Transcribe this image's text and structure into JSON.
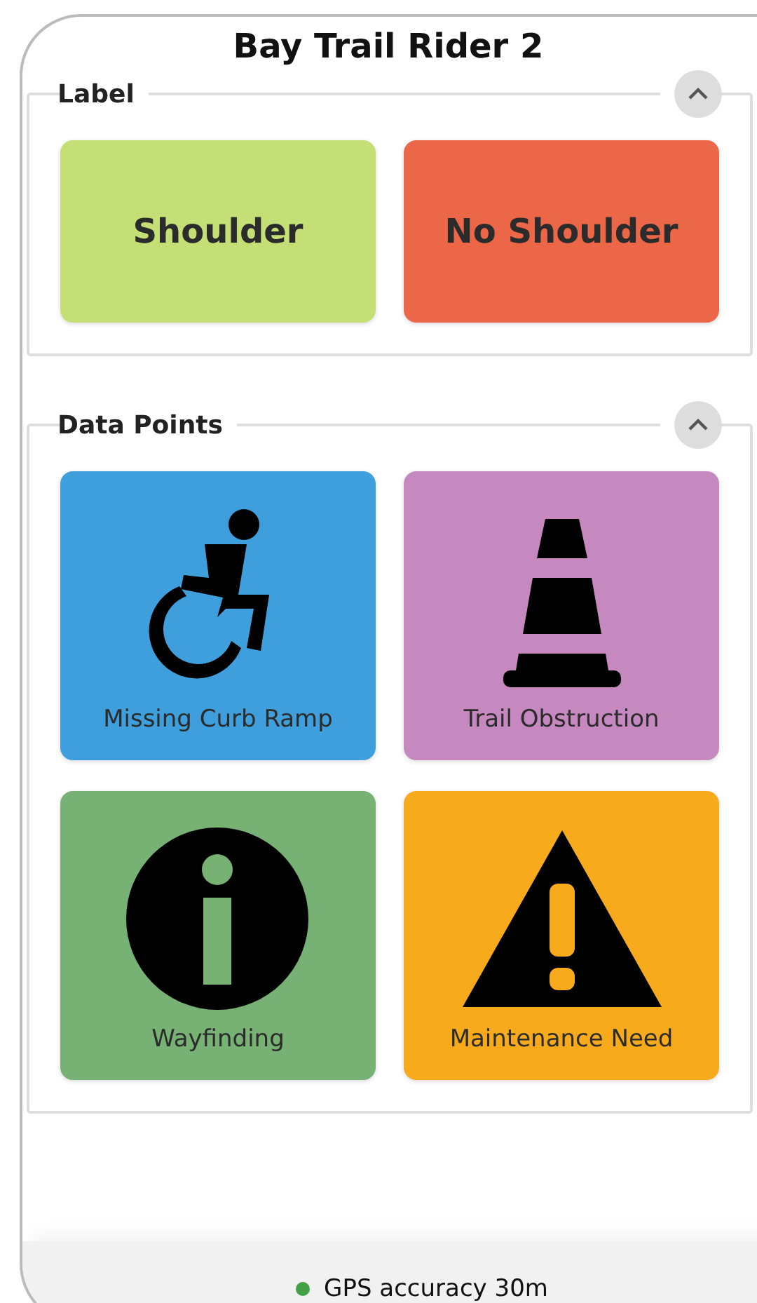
{
  "title": "Bay Trail Rider 2",
  "sections": [
    {
      "heading": "Label",
      "expanded": true,
      "kind": "label",
      "tiles": [
        {
          "label": "Shoulder",
          "color": "#c4df75"
        },
        {
          "label": "No Shoulder",
          "color": "#eb6748"
        }
      ]
    },
    {
      "heading": "Data Points",
      "expanded": true,
      "kind": "point",
      "tiles": [
        {
          "label": "Missing Curb Ramp",
          "color": "#3f9fdc"
        },
        {
          "label": "Trail Obstruction",
          "color": "#c589bf"
        },
        {
          "label": "Wayfinding",
          "color": "#77b274"
        },
        {
          "label": "Maintenance Need",
          "color": "#f7aa1b"
        }
      ]
    }
  ],
  "status": {
    "text": "GPS accuracy 30m",
    "color": "#43a047"
  }
}
